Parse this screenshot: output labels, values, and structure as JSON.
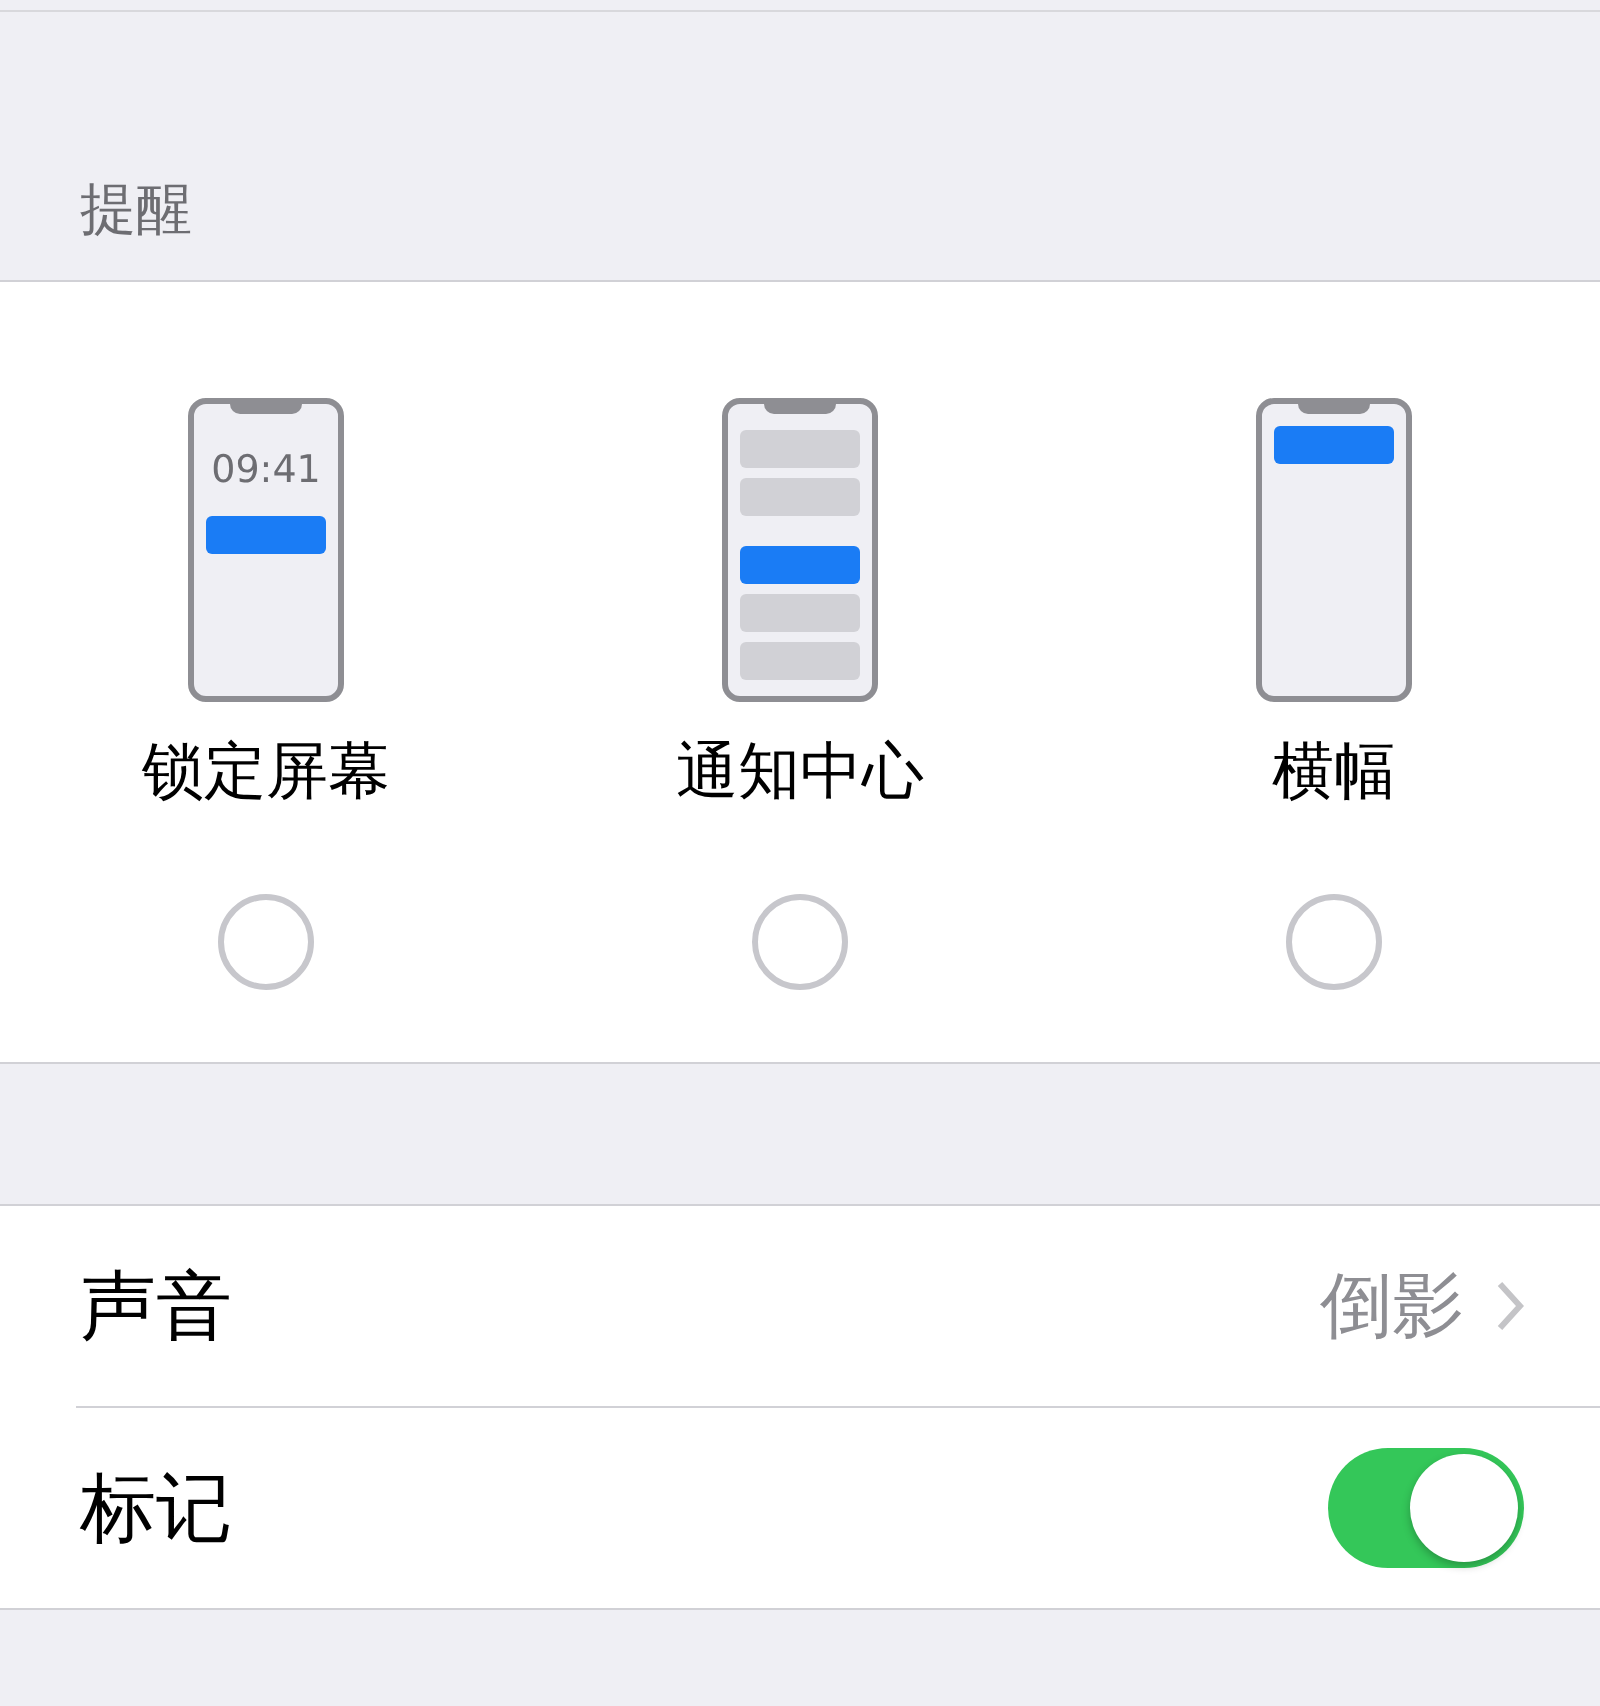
{
  "section_header": "提醒",
  "alert_styles": [
    {
      "kind": "lock_screen",
      "label": "锁定屏幕",
      "time": "09:41",
      "selected": false
    },
    {
      "kind": "notification_center",
      "label": "通知中心",
      "selected": false
    },
    {
      "kind": "banner",
      "label": "横幅",
      "selected": false
    }
  ],
  "rows": [
    {
      "kind": "disclosure",
      "label": "声音",
      "value": "倒影"
    },
    {
      "kind": "toggle",
      "label": "标记",
      "on": true
    }
  ]
}
